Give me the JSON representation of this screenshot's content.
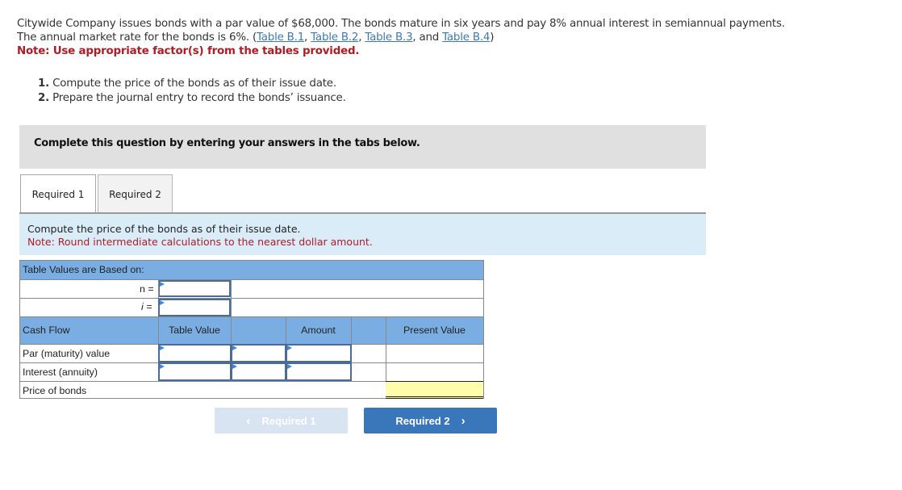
{
  "problem": {
    "text_before_links": "Citywide Company issues bonds with a par value of $68,000. The bonds mature in six years and pay 8% annual interest in semiannual payments. The annual market rate for the bonds is 6%. (",
    "links": [
      "Table B.1",
      "Table B.2",
      "Table B.3",
      "Table B.4"
    ],
    "sep_comma": ", ",
    "sep_and": ", and ",
    "close_paren": ")",
    "note": "Note: Use appropriate factor(s) from the tables provided."
  },
  "requirements": [
    {
      "num": "1.",
      "text": " Compute the price of the bonds as of their issue date."
    },
    {
      "num": "2.",
      "text": " Prepare the journal entry to record the bonds’ issuance."
    }
  ],
  "instruction": "Complete this question by entering your answers in the tabs below.",
  "tabs": [
    {
      "label": "Required 1",
      "active": true
    },
    {
      "label": "Required 2",
      "active": false
    }
  ],
  "prompt": {
    "text": "Compute the price of the bonds as of their issue date.",
    "note": "Note: Round intermediate calculations to the nearest dollar amount."
  },
  "table": {
    "based_on_header": "Table Values are Based on:",
    "n_label": "n =",
    "i_label": "i =",
    "n_value": "",
    "i_value": "",
    "columns": {
      "cash_flow": "Cash Flow",
      "table_value": "Table Value",
      "amount": "Amount",
      "present_value": "Present Value"
    },
    "rows": [
      {
        "label": "Par (maturity) value",
        "table_value": "",
        "operator": "",
        "amount": "",
        "present_value": ""
      },
      {
        "label": "Interest (annuity)",
        "table_value": "",
        "operator": "",
        "amount": "",
        "present_value": ""
      }
    ],
    "total_label": "Price of bonds",
    "total_value": ""
  },
  "navigation": {
    "prev_label": "Required 1",
    "next_label": "Required 2",
    "prev_icon": "‹",
    "next_icon": "›",
    "prev_enabled": false
  }
}
